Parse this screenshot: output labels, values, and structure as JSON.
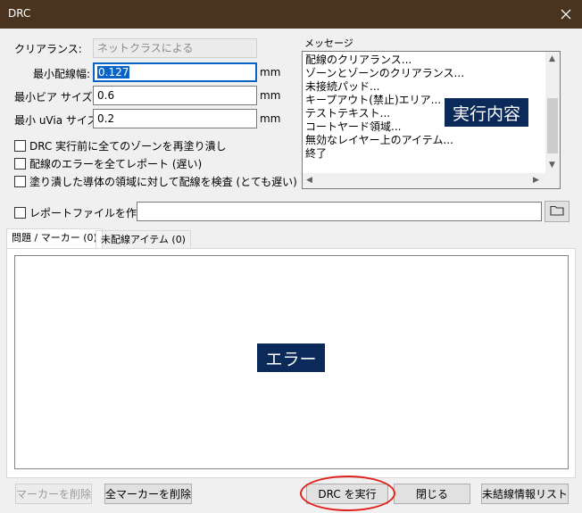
{
  "window": {
    "title": "DRC"
  },
  "rules": {
    "clearance_label": "クリアランス:",
    "clearance_value": "ネットクラスによる",
    "min_track_label": "最小配線幅:",
    "min_track_value": "0.127",
    "min_via_label": "最小ビア サイズ:",
    "min_via_value": "0.6",
    "min_uvia_label": "最小 uVia サイズ:",
    "min_uvia_value": "0.2",
    "unit": "mm"
  },
  "options": [
    {
      "label": "DRC 実行前に全てのゾーンを再塗り潰し"
    },
    {
      "label": "配線のエラーを全てレポート (遅い)"
    },
    {
      "label": "塗り潰した導体の領域に対して配線を検査 (とても遅い)"
    }
  ],
  "report_file": {
    "label": "レポートファイルを作成:",
    "value": ""
  },
  "messages": {
    "label": "メッセージ",
    "lines": [
      "配線のクリアランス...",
      "ゾーンとゾーンのクリアランス...",
      "未接続パッド...",
      "キープアウト(禁止)エリア...",
      "テストテキスト...",
      "コートヤード領域...",
      "無効なレイヤー上のアイテム...",
      "終了"
    ],
    "overlay": "実行内容"
  },
  "tabs": [
    {
      "label": "問題 / マーカー (0)"
    },
    {
      "label": "未配線アイテム (0)"
    }
  ],
  "errors_overlay": "エラー",
  "buttons": {
    "delete_marker": "マーカーを削除",
    "delete_all_markers": "全マーカーを削除",
    "run_drc": "DRC を実行",
    "close": "閉じる",
    "unconnected_list": "未結線情報リスト"
  },
  "colors": {
    "titlebar": "#4a3420",
    "overlay": "#0b2a5a",
    "annotation": "#e0201c",
    "focus": "#0a64c8"
  }
}
